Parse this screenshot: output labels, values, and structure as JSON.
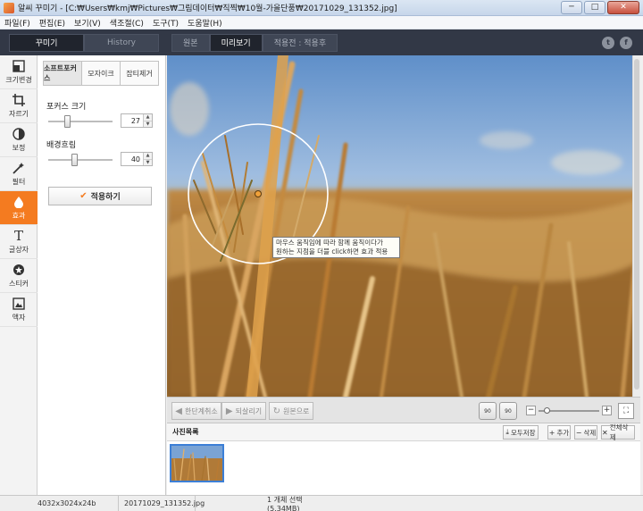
{
  "window": {
    "title": "알씨 꾸미기 - [C:₩Users₩kmj₩Pictures₩그림데이터₩직찍₩10월-가을단풍₩20171029_131352.jpg]",
    "controls": [
      "─",
      "□",
      "✕"
    ]
  },
  "menu": [
    "파일(F)",
    "편집(E)",
    "보기(V)",
    "색조절(C)",
    "도구(T)",
    "도움말(H)"
  ],
  "topbar": {
    "mode_tabs": [
      "꾸미기",
      "History"
    ],
    "view_tabs": [
      "원본",
      "미리보기",
      "적용전 : 적용후"
    ],
    "social": [
      "t",
      "f"
    ]
  },
  "sidebar": {
    "tools": [
      {
        "label": "크기변경",
        "icon": "resize-icon"
      },
      {
        "label": "자르기",
        "icon": "crop-icon"
      },
      {
        "label": "보정",
        "icon": "contrast-icon"
      },
      {
        "label": "필터",
        "icon": "filter-wand-icon"
      },
      {
        "label": "효과",
        "icon": "drop-icon",
        "active": true
      },
      {
        "label": "글상자",
        "icon": "text-icon"
      },
      {
        "label": "스티커",
        "icon": "sticker-icon"
      },
      {
        "label": "액자",
        "icon": "frame-icon"
      }
    ]
  },
  "panel": {
    "tabs": [
      "소프트포커스",
      "모자이크",
      "잡티제거"
    ],
    "focus_size_label": "포커스 크기",
    "focus_size_value": "27",
    "focus_size_fraction": 0.27,
    "blur_label": "배경흐림",
    "blur_value": "40",
    "blur_fraction": 0.4,
    "apply_label": "적용하기"
  },
  "viewer": {
    "tooltip_line1": "마우스 움직임에 따라 함께 움직이다가",
    "tooltip_line2": "원하는 지점을 더블 click하면 효과 적용"
  },
  "editbar": {
    "undo": "한단계취소",
    "redo": "되살리기",
    "revert": "원본으로",
    "rotate_left": "90",
    "rotate_right": "90",
    "zoom_minus": "−",
    "zoom_plus": "+",
    "fit": "⛶"
  },
  "photolist": {
    "title": "사진목록",
    "save_all": "모두저장",
    "add": "추가",
    "remove": "삭제",
    "remove_all": "전체삭제"
  },
  "status": {
    "dimensions": "4032x3024x24b",
    "filename": "20171029_131352.jpg",
    "selection": "1 개체 선택(5.34MB)"
  },
  "colors": {
    "accent": "#f47b20",
    "toolbar_dark": "#323846",
    "selection_blue": "#3c7fd6"
  }
}
